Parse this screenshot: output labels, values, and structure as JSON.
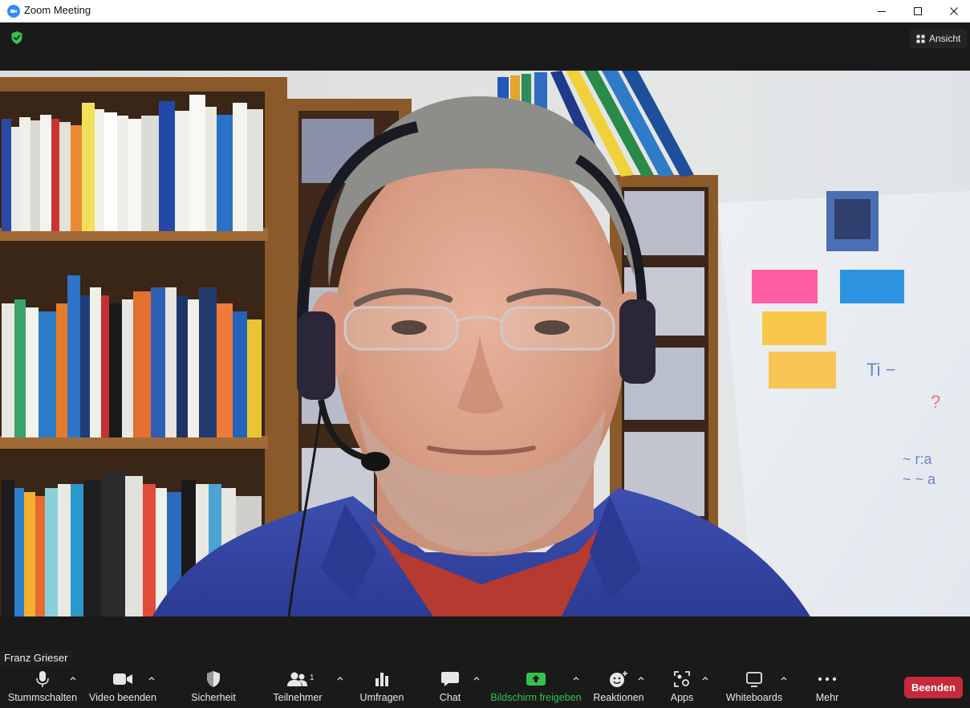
{
  "window": {
    "title": "Zoom Meeting"
  },
  "top_bar": {
    "view_label": "Ansicht"
  },
  "participant": {
    "name": "Franz Grieser"
  },
  "toolbar": {
    "mute": "Stummschalten",
    "video": "Video beenden",
    "security": "Sicherheit",
    "participants": "Teilnehmer",
    "participants_count": "1",
    "polls": "Umfragen",
    "chat": "Chat",
    "share": "Bildschirm freigeben",
    "reactions": "Reaktionen",
    "apps": "Apps",
    "whiteboards": "Whiteboards",
    "more": "Mehr",
    "end": "Beenden"
  },
  "colors": {
    "share_green": "#35c24b",
    "end_red": "#c7293a",
    "zoom_blue": "#2d8cff",
    "security_shield": "#35c24b"
  }
}
